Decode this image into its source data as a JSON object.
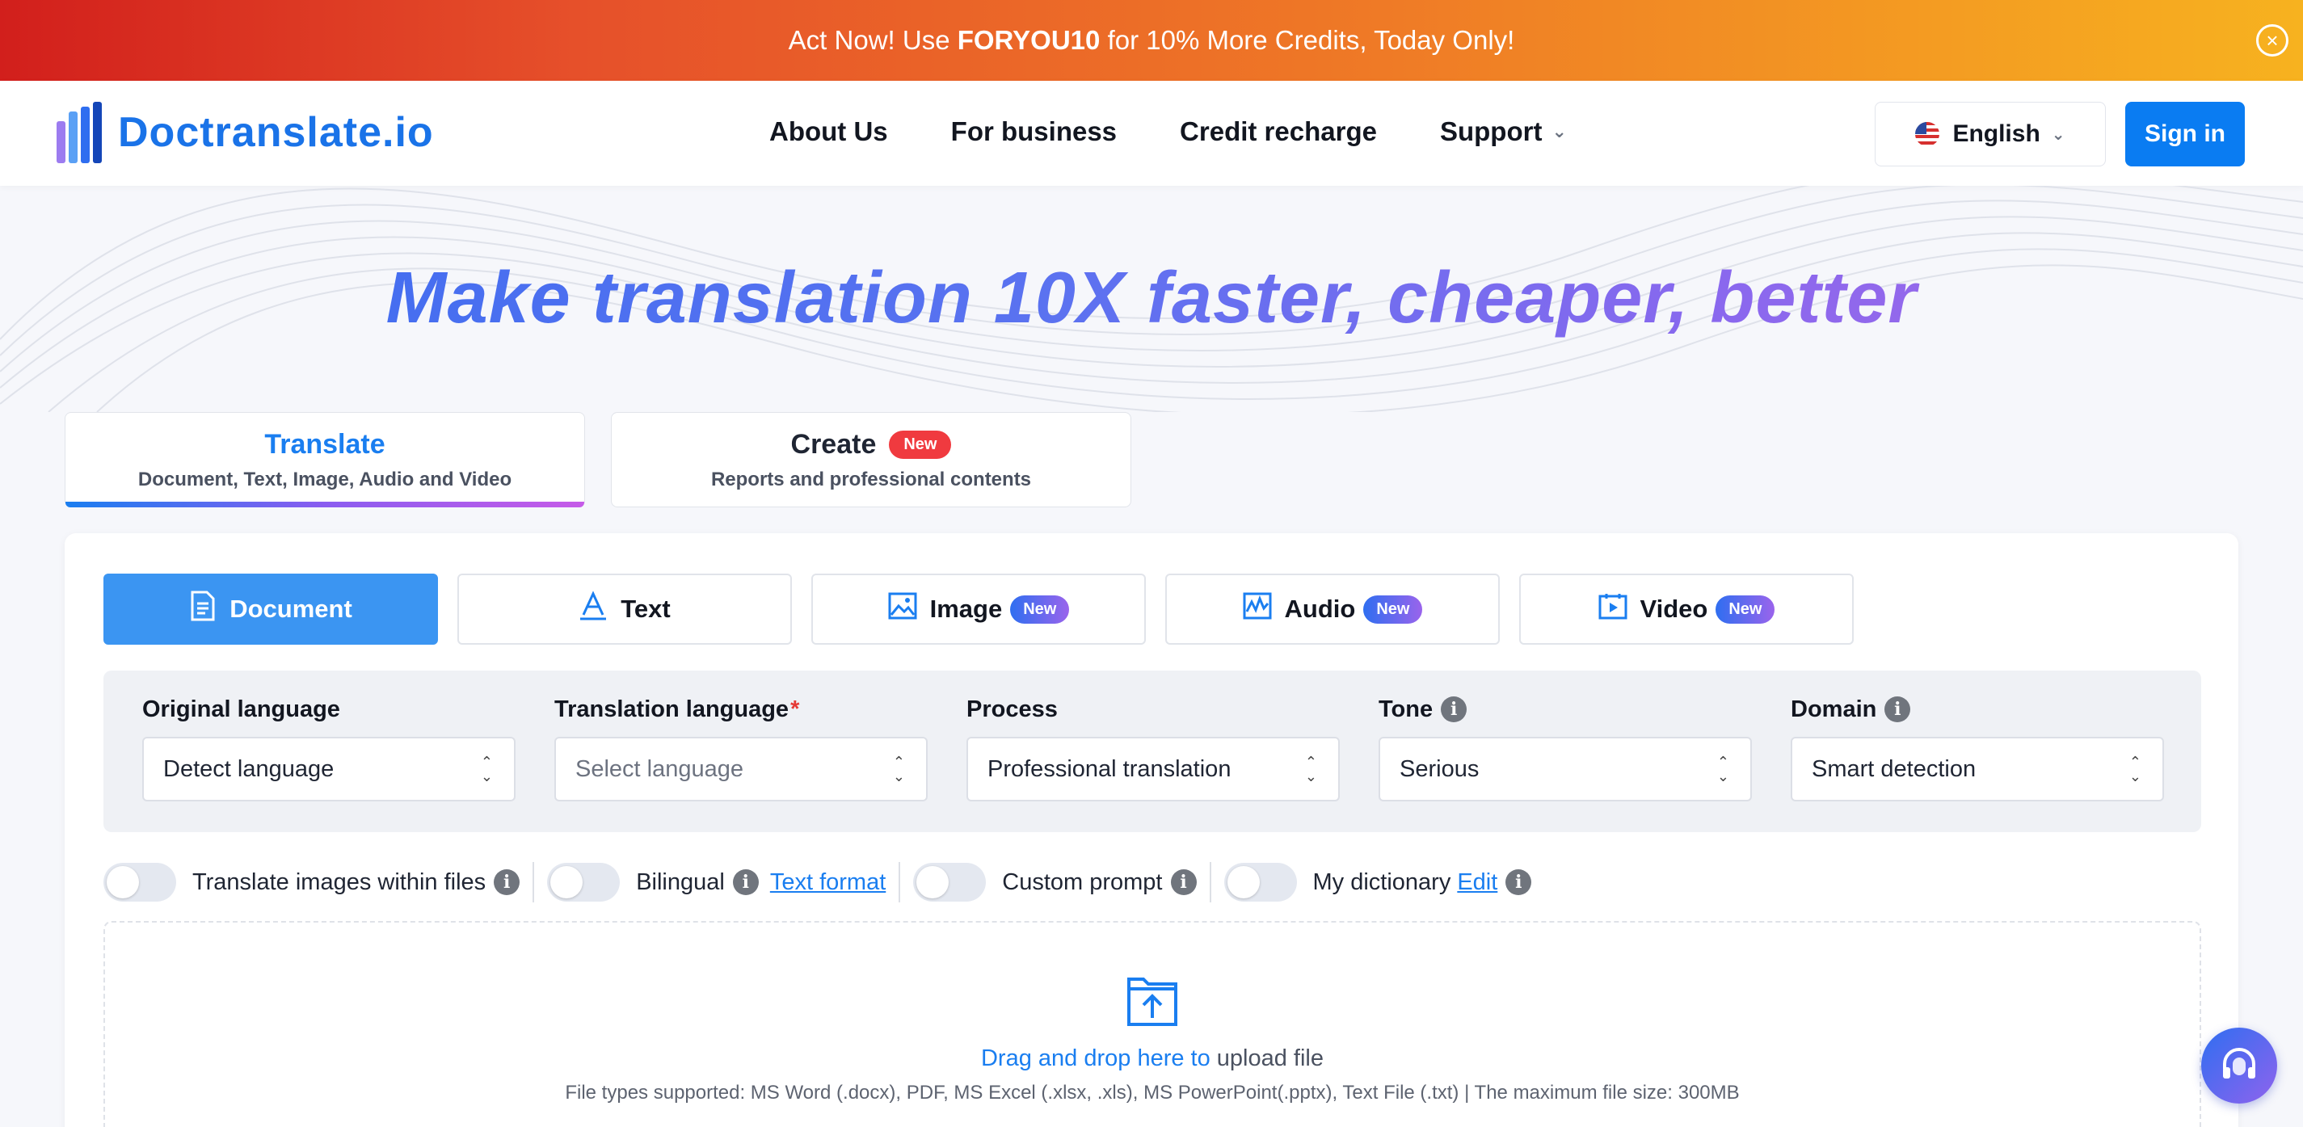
{
  "promo": {
    "prefix": "Act Now! Use ",
    "code": "FORYOU10",
    "suffix": " for 10% More Credits, Today Only!",
    "close_icon": "close-circle-icon"
  },
  "nav": {
    "logo_text": "Doctranslate.io",
    "links": [
      "About Us",
      "For business",
      "Credit recharge",
      "Support"
    ],
    "language": "English",
    "sign_in": "Sign in"
  },
  "hero": {
    "title": "Make translation 10X faster, cheaper, better"
  },
  "mode_tabs": [
    {
      "title": "Translate",
      "subtitle": "Document, Text, Image, Audio and Video",
      "active": true
    },
    {
      "title": "Create",
      "badge": "New",
      "subtitle": "Reports and professional contents",
      "active": false
    }
  ],
  "type_tabs": [
    {
      "label": "Document",
      "icon": "document-icon",
      "active": true
    },
    {
      "label": "Text",
      "icon": "text-icon",
      "active": false
    },
    {
      "label": "Image",
      "icon": "image-icon",
      "badge": "New"
    },
    {
      "label": "Audio",
      "icon": "audio-icon",
      "badge": "New"
    },
    {
      "label": "Video",
      "icon": "video-icon",
      "badge": "New"
    }
  ],
  "settings": {
    "original_language": {
      "label": "Original language",
      "value": "Detect language"
    },
    "translation_language": {
      "label": "Translation language",
      "required": "*",
      "placeholder": "Select language"
    },
    "process": {
      "label": "Process",
      "value": "Professional translation"
    },
    "tone": {
      "label": "Tone",
      "value": "Serious"
    },
    "domain": {
      "label": "Domain",
      "value": "Smart detection"
    }
  },
  "options": {
    "translate_images": "Translate images within files",
    "bilingual": "Bilingual",
    "text_format": "Text format",
    "custom_prompt": "Custom prompt",
    "my_dictionary": "My dictionary",
    "edit": "Edit"
  },
  "upload": {
    "drag_text": "Drag and drop here to",
    "upload_text": " upload file",
    "supported": "File types supported: MS Word (.docx), PDF, MS Excel (.xlsx, .xls), MS PowerPoint(.pptx), Text File (.txt) | The maximum file size: 300MB"
  },
  "colors": {
    "primary": "#1a7ef0",
    "active_tab": "#3b95f2",
    "badge_red": "#f03a3f"
  }
}
